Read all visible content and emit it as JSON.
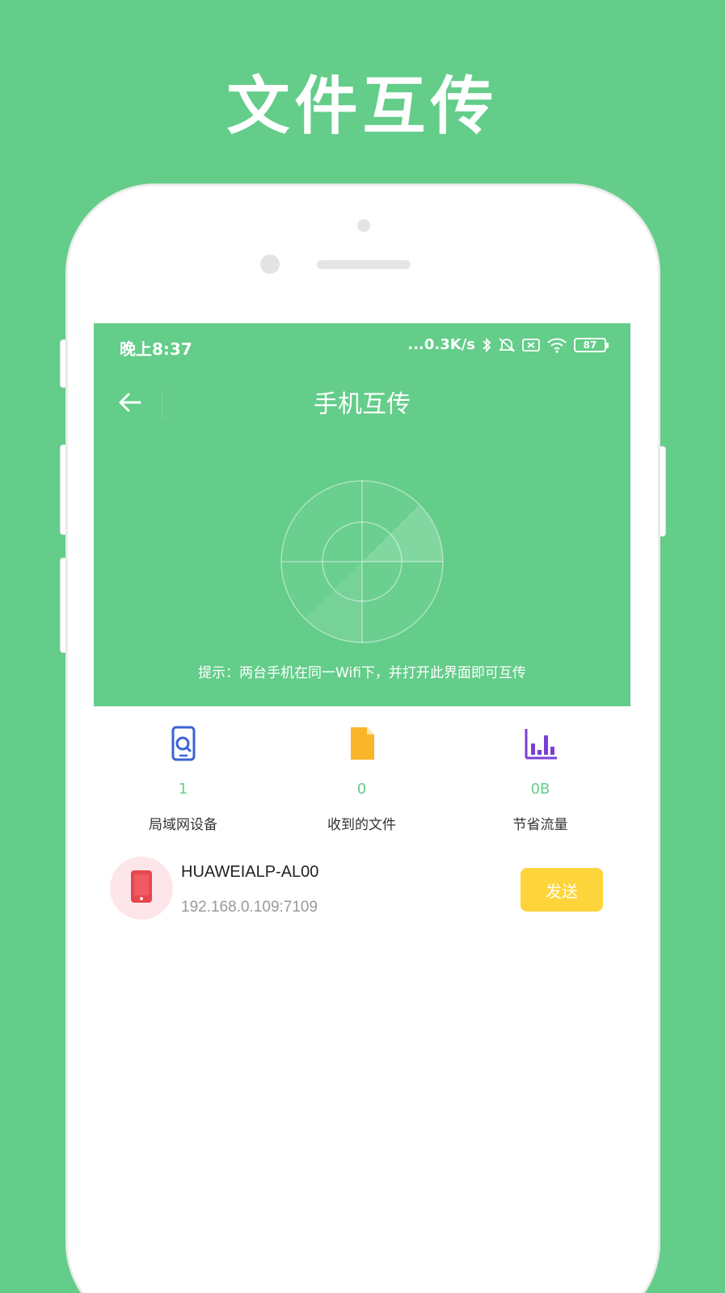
{
  "promo": {
    "title": "文件互传"
  },
  "status_bar": {
    "time": "晚上8:37",
    "network_speed": "...0.3K/s",
    "battery": "87"
  },
  "nav": {
    "title": "手机互传"
  },
  "hint": "提示：两台手机在同一Wifi下，并打开此界面即可互传",
  "stats": [
    {
      "icon": "phone-search-icon",
      "value": "1",
      "label": "局域网设备",
      "color": "#3a63d6"
    },
    {
      "icon": "file-icon",
      "value": "0",
      "label": "收到的文件",
      "color": "#fbb52a"
    },
    {
      "icon": "bar-chart-icon",
      "value": "0B",
      "label": "节省流量",
      "color": "#7b3fd4"
    }
  ],
  "devices": [
    {
      "name": "HUAWEIALP-AL00",
      "ip": "192.168.0.109:7109",
      "icon": "phone-icon",
      "send_label": "发送"
    }
  ],
  "colors": {
    "brand_green": "#63cd89",
    "send_yellow": "#fdd43a",
    "device_red": "#e8464f"
  }
}
